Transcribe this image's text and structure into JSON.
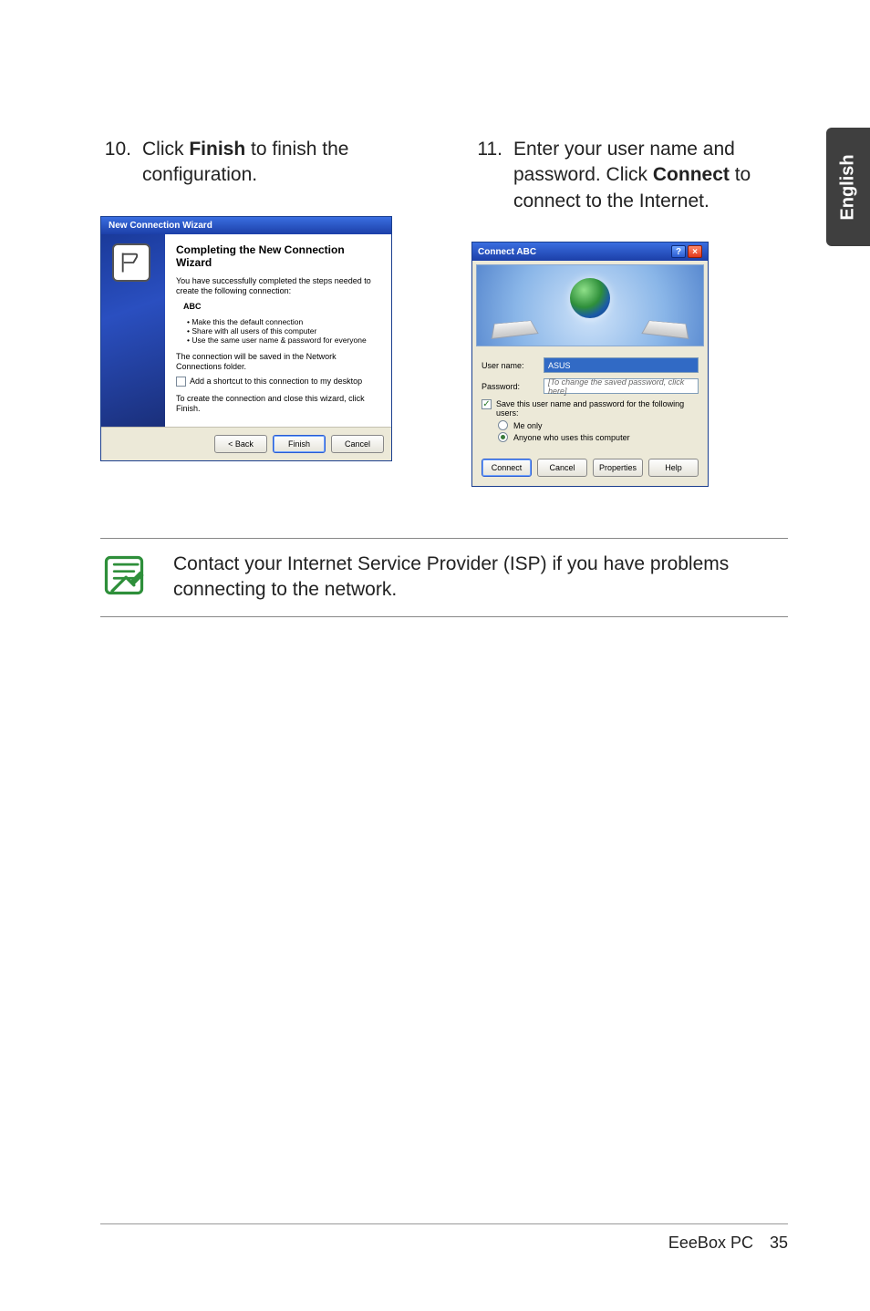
{
  "side_tab": {
    "label": "English"
  },
  "steps": {
    "left": {
      "num": "10.",
      "pre": "Click ",
      "bold": "Finish",
      "post": " to finish the configuration."
    },
    "right": {
      "num": "11.",
      "pre": "Enter your user name and password. Click ",
      "bold": "Connect",
      "post": " to connect to the Internet."
    }
  },
  "wizard": {
    "title": "New Connection Wizard",
    "heading": "Completing the New Connection Wizard",
    "intro": "You have successfully completed the steps needed to create the following connection:",
    "conn_name": "ABC",
    "bullets": [
      "Make this the default connection",
      "Share with all users of this computer",
      "Use the same user name & password for everyone"
    ],
    "saved_text": "The connection will be saved in the Network Connections folder.",
    "shortcut_label": "Add a shortcut to this connection to my desktop",
    "close_text": "To create the connection and close this wizard, click Finish.",
    "buttons": {
      "back": "< Back",
      "finish": "Finish",
      "cancel": "Cancel"
    }
  },
  "dialog": {
    "title": "Connect ABC",
    "username_label": "User name:",
    "username_value": "ASUS",
    "password_label": "Password:",
    "password_placeholder": "[To change the saved password, click here]",
    "save_label": "Save this user name and password for the following users:",
    "radio_me": "Me only",
    "radio_anyone": "Anyone who uses this computer",
    "buttons": {
      "connect": "Connect",
      "cancel": "Cancel",
      "properties": "Properties",
      "help": "Help"
    }
  },
  "note": {
    "text": "Contact your Internet Service Provider (ISP) if you have problems connecting to the network."
  },
  "footer": {
    "product": "EeeBox PC",
    "page": "35"
  }
}
